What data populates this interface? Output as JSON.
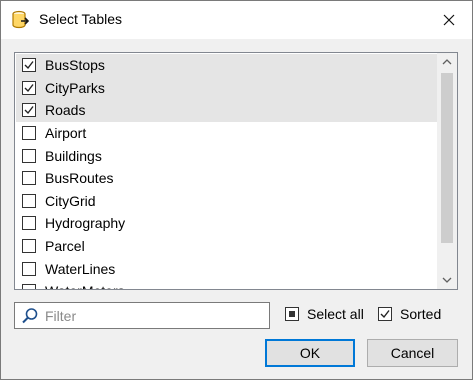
{
  "window": {
    "title": "Select Tables",
    "icon": "database-export-icon"
  },
  "tables": [
    {
      "label": "BusStops",
      "checked": true
    },
    {
      "label": "CityParks",
      "checked": true
    },
    {
      "label": "Roads",
      "checked": true
    },
    {
      "label": "Airport",
      "checked": false
    },
    {
      "label": "Buildings",
      "checked": false
    },
    {
      "label": "BusRoutes",
      "checked": false
    },
    {
      "label": "CityGrid",
      "checked": false
    },
    {
      "label": "Hydrography",
      "checked": false
    },
    {
      "label": "Parcel",
      "checked": false
    },
    {
      "label": "WaterLines",
      "checked": false
    },
    {
      "label": "WaterMeters",
      "checked": false
    }
  ],
  "filter": {
    "placeholder": "Filter",
    "value": ""
  },
  "options": {
    "select_all": {
      "label": "Select all",
      "state": "indeterminate"
    },
    "sorted": {
      "label": "Sorted",
      "checked": true
    }
  },
  "buttons": {
    "ok": "OK",
    "cancel": "Cancel"
  },
  "colors": {
    "accent": "#0078d7",
    "selected_row": "#e5e5e5"
  }
}
